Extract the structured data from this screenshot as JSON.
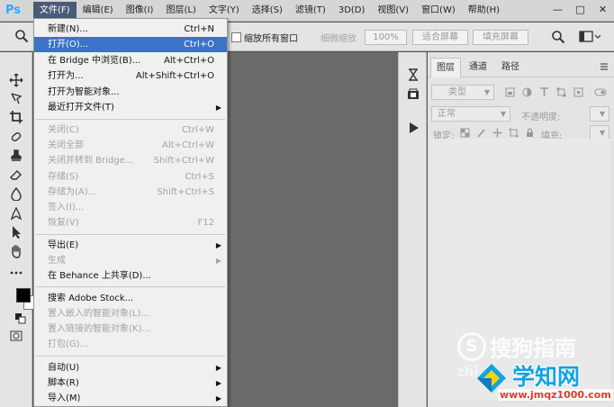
{
  "menubar": {
    "logo": "Ps",
    "items": [
      "文件(F)",
      "编辑(E)",
      "图像(I)",
      "图层(L)",
      "文字(Y)",
      "选择(S)",
      "滤镜(T)",
      "3D(D)",
      "视图(V)",
      "窗口(W)",
      "帮助(H)"
    ],
    "active_index": 0,
    "window_controls": {
      "minimize": "—",
      "restore": "□",
      "close": "✕"
    }
  },
  "options": {
    "resize_all_windows": "缩放所有窗口",
    "scrubby_zoom": "细微缩放",
    "zoom_100": "100%",
    "fit_screen": "适合屏幕",
    "fill_screen": "填充屏幕"
  },
  "file_menu": {
    "items": [
      {
        "label": "新建(N)...",
        "shortcut": "Ctrl+N"
      },
      {
        "label": "打开(O)...",
        "shortcut": "Ctrl+O",
        "highlighted": true
      },
      {
        "label": "在 Bridge 中浏览(B)...",
        "shortcut": "Alt+Ctrl+O"
      },
      {
        "label": "打开为...",
        "shortcut": "Alt+Shift+Ctrl+O"
      },
      {
        "label": "打开为智能对象..."
      },
      {
        "label": "最近打开文件(T)",
        "submenu": true
      },
      {
        "separator": true
      },
      {
        "label": "关闭(C)",
        "shortcut": "Ctrl+W",
        "disabled": true
      },
      {
        "label": "关闭全部",
        "shortcut": "Alt+Ctrl+W",
        "disabled": true
      },
      {
        "label": "关闭并转到 Bridge...",
        "shortcut": "Shift+Ctrl+W",
        "disabled": true
      },
      {
        "label": "存储(S)",
        "shortcut": "Ctrl+S",
        "disabled": true
      },
      {
        "label": "存储为(A)...",
        "shortcut": "Shift+Ctrl+S",
        "disabled": true
      },
      {
        "label": "签入(I)...",
        "disabled": true
      },
      {
        "label": "恢复(V)",
        "shortcut": "F12",
        "disabled": true
      },
      {
        "separator": true
      },
      {
        "label": "导出(E)",
        "submenu": true
      },
      {
        "label": "生成",
        "submenu": true,
        "disabled": true
      },
      {
        "label": "在 Behance 上共享(D)..."
      },
      {
        "separator": true
      },
      {
        "label": "搜索 Adobe Stock..."
      },
      {
        "label": "置入嵌入的智能对象(L)...",
        "disabled": true
      },
      {
        "label": "置入链接的智能对象(K)...",
        "disabled": true
      },
      {
        "label": "打包(G)...",
        "disabled": true
      },
      {
        "separator": true
      },
      {
        "label": "自动(U)",
        "submenu": true
      },
      {
        "label": "脚本(R)",
        "submenu": true
      },
      {
        "label": "导入(M)",
        "submenu": true
      }
    ]
  },
  "layers_panel": {
    "tabs": [
      "图层",
      "通道",
      "路径"
    ],
    "active_tab": 0,
    "filter_kind": "类型",
    "blend_mode": "正常",
    "opacity_label": "不透明度:",
    "lock_label": "锁定:",
    "fill_label": "填充:"
  },
  "watermarks": {
    "sogou_text": "搜狗指南",
    "sogou_partial": "zhi",
    "xzw_title": "学知网",
    "xzw_url": "www.jmqz1000.com"
  },
  "colors": {
    "menu_highlight": "#3a73c8",
    "canvas_bg": "#6a6a6a",
    "panel_bg": "#e4e4e4",
    "ps_blue": "#31a8ff"
  }
}
